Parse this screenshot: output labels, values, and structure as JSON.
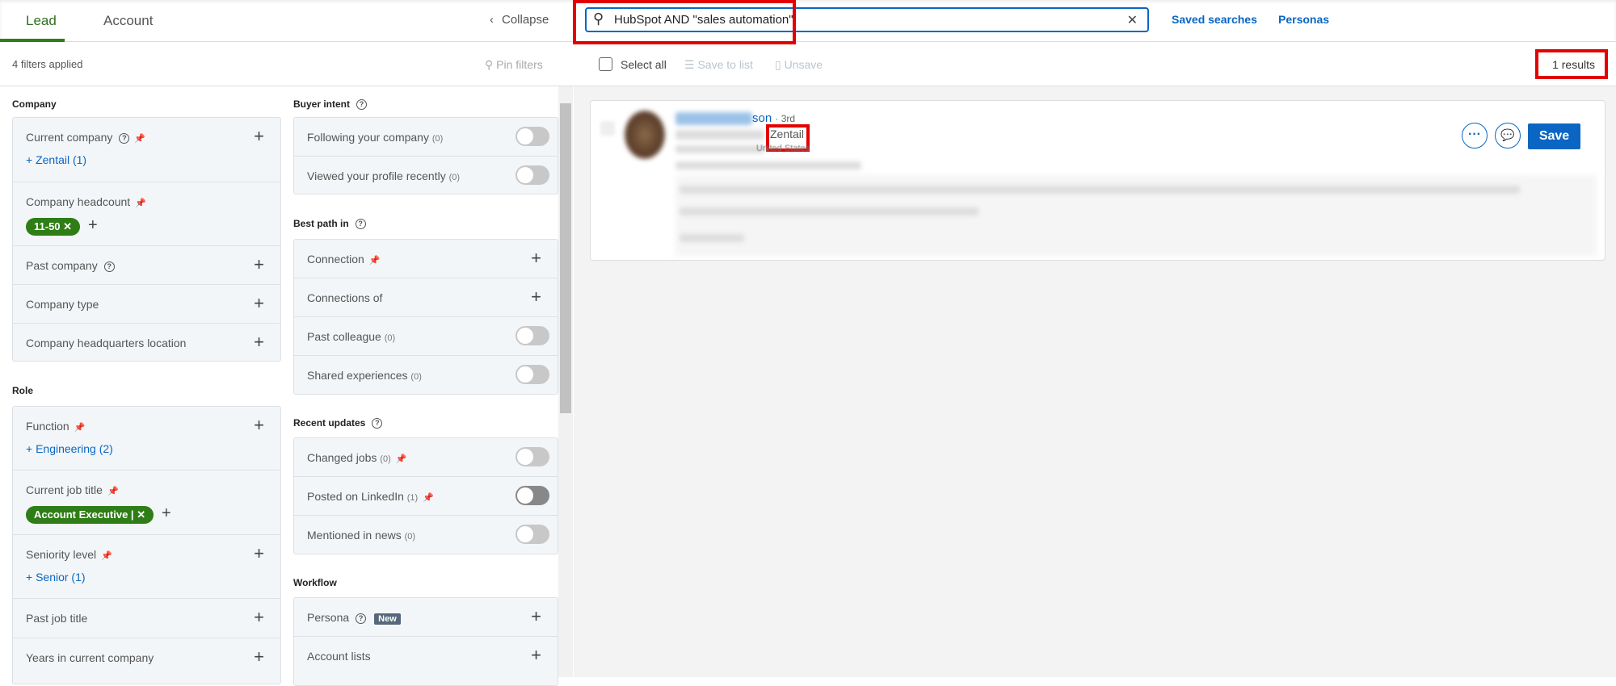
{
  "header": {
    "tabs": [
      {
        "label": "Lead",
        "active": true
      },
      {
        "label": "Account",
        "active": false
      }
    ],
    "collapse_label": "Collapse",
    "search_value": "HubSpot AND \"sales automation\"",
    "saved_searches": "Saved searches",
    "personas": "Personas"
  },
  "toolbar": {
    "filters_applied": "4 filters applied",
    "pin_filters": "Pin filters",
    "select_all": "Select all",
    "save_to_list": "Save to list",
    "unsave": "Unsave",
    "results_count": "1 results"
  },
  "filters": {
    "company": {
      "title": "Company",
      "items": [
        {
          "label": "Current company",
          "selected": "Zentail (1)"
        },
        {
          "label": "Company headcount",
          "chip": "11-50"
        },
        {
          "label": "Past company"
        },
        {
          "label": "Company type"
        },
        {
          "label": "Company headquarters location"
        }
      ]
    },
    "role": {
      "title": "Role",
      "items": [
        {
          "label": "Function",
          "selected": "Engineering (2)"
        },
        {
          "label": "Current job title",
          "chip": "Account Executive |"
        },
        {
          "label": "Seniority level",
          "selected": "Senior (1)"
        },
        {
          "label": "Past job title"
        },
        {
          "label": "Years in current company"
        }
      ]
    },
    "buyer_intent": {
      "title": "Buyer intent",
      "items": [
        {
          "label": "Following your company",
          "count": "(0)"
        },
        {
          "label": "Viewed your profile recently",
          "count": "(0)"
        }
      ]
    },
    "best_path": {
      "title": "Best path in",
      "items": [
        {
          "label": "Connection"
        },
        {
          "label": "Connections of"
        },
        {
          "label": "Past colleague",
          "count": "(0)"
        },
        {
          "label": "Shared experiences",
          "count": "(0)"
        }
      ]
    },
    "recent_updates": {
      "title": "Recent updates",
      "items": [
        {
          "label": "Changed jobs",
          "count": "(0)"
        },
        {
          "label": "Posted on LinkedIn",
          "count": "(1)"
        },
        {
          "label": "Mentioned in news",
          "count": "(0)"
        }
      ]
    },
    "workflow": {
      "title": "Workflow",
      "items": [
        {
          "label": "Persona",
          "badge": "New"
        },
        {
          "label": "Account lists"
        }
      ]
    }
  },
  "result": {
    "name_visible": "son",
    "degree": "· 3rd",
    "company": "Zentail",
    "location": "United States",
    "save_label": "Save",
    "more_label": "···"
  },
  "colors": {
    "accent": "#0a66c2",
    "chip": "#2f7d16",
    "highlight": "#e30000"
  }
}
